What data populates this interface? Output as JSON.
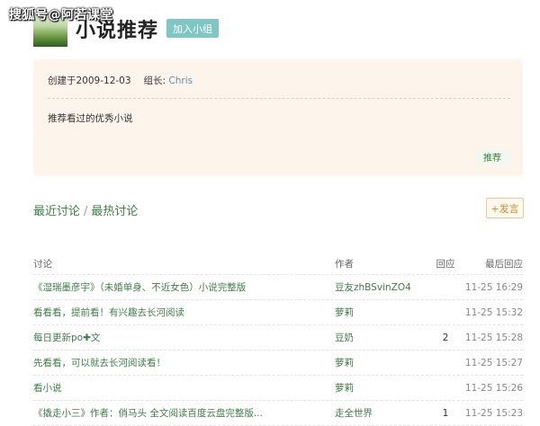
{
  "watermark": "搜狐号@阿若课堂",
  "group": {
    "title": "小说推荐",
    "join_label": "加入小组",
    "created_label": "创建于2009-12-03",
    "leader_label": "组长:",
    "leader_name": "Chris",
    "description": "推荐看过的优秀小说",
    "recommend_label": "推荐"
  },
  "tabs": {
    "recent": "最近讨论",
    "separator": "/",
    "hot": "最热讨论",
    "post_label": "+发言"
  },
  "table": {
    "headers": {
      "title": "讨论",
      "author": "作者",
      "replies": "回应",
      "last": "最后回应"
    },
    "rows": [
      {
        "title": "《湿瑞墨彦宇》（未婚单身、不近女色）小说完整版",
        "author": "豆友zhBSvinZO4",
        "replies": "",
        "last": "11-25 16:29"
      },
      {
        "title": "看看看，提前看！有兴趣去长河阅读",
        "author": "萝莉",
        "replies": "",
        "last": "11-25 15:32"
      },
      {
        "title": "每日更新po✚文",
        "author": "豆奶",
        "replies": "2",
        "last": "11-25 15:28"
      },
      {
        "title": "先看看，可以就去长河阅读看！",
        "author": "萝莉",
        "replies": "",
        "last": "11-25 15:27"
      },
      {
        "title": "看小说",
        "author": "萝莉",
        "replies": "",
        "last": "11-25 15:26"
      },
      {
        "title": "《撬走小三》作者：俏马头 全文阅读百度云盘完整版...",
        "author": "走全世界",
        "replies": "1",
        "last": "11-25 15:23"
      }
    ]
  }
}
